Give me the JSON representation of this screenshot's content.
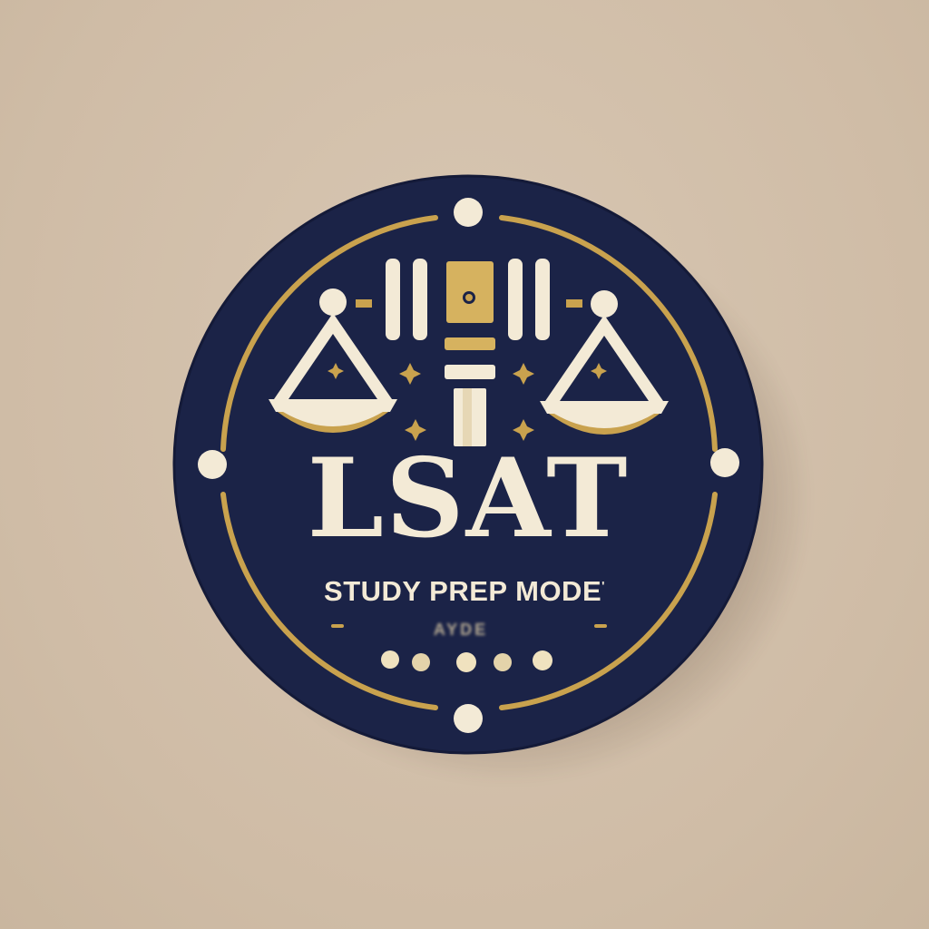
{
  "logo": {
    "title": "LSAT",
    "subtitle": "STUDY PREP MODE",
    "subtitle_mark": "'",
    "faint_text": "AYDE",
    "icons": [
      "gavel-icon",
      "scales-of-justice-icon"
    ]
  },
  "colors": {
    "background": "#d4c2ad",
    "badge_navy": "#1b2347",
    "gold": "#c9a24e",
    "cream": "#f3ead6"
  }
}
